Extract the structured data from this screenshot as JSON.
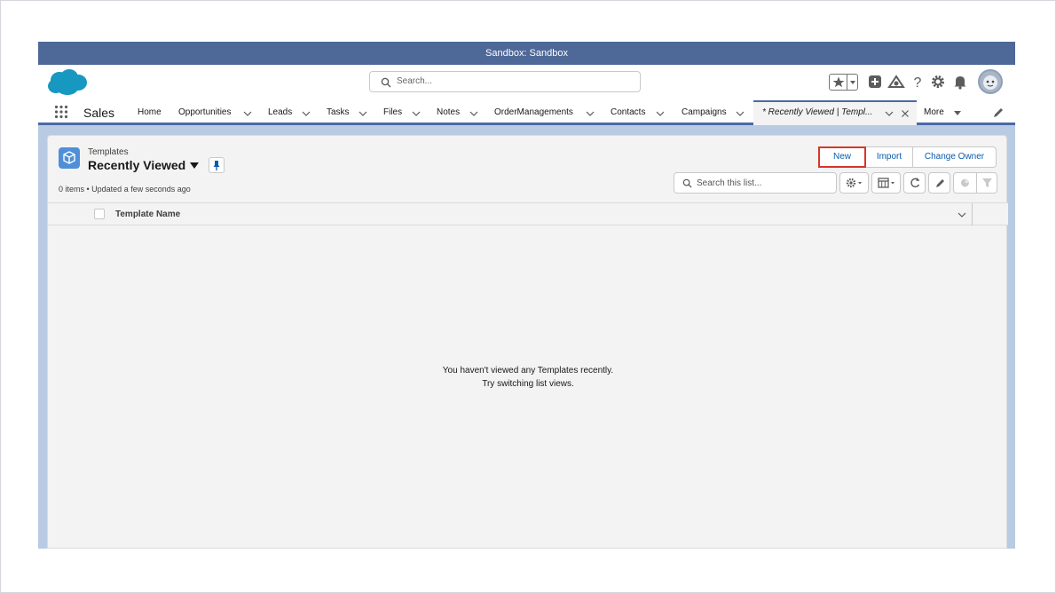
{
  "sandbox_banner": "Sandbox: Sandbox",
  "header": {
    "search_placeholder": "Search...",
    "icons": [
      "salesforce-cloud-logo",
      "star-icon",
      "plus-icon",
      "trailhead-icon",
      "help-icon",
      "gear-icon",
      "bell-icon",
      "avatar"
    ]
  },
  "nav": {
    "app_name": "Sales",
    "items": [
      {
        "label": "Home",
        "has_menu": false
      },
      {
        "label": "Opportunities",
        "has_menu": true
      },
      {
        "label": "Leads",
        "has_menu": true
      },
      {
        "label": "Tasks",
        "has_menu": true
      },
      {
        "label": "Files",
        "has_menu": true
      },
      {
        "label": "Notes",
        "has_menu": true
      },
      {
        "label": "OrderManagements",
        "has_menu": true
      },
      {
        "label": "Contacts",
        "has_menu": true
      },
      {
        "label": "Campaigns",
        "has_menu": true
      }
    ],
    "active_tab": "* Recently Viewed | Templ...",
    "more_label": "More"
  },
  "list_view": {
    "object_type": "Templates",
    "list_name": "Recently Viewed",
    "status": "0 items • Updated a few seconds ago",
    "buttons": {
      "new": "New",
      "import": "Import",
      "change_owner": "Change Owner"
    },
    "search_placeholder": "Search this list...",
    "columns": [
      "Template Name"
    ],
    "empty_line1": "You haven't viewed any Templates recently.",
    "empty_line2": "Try switching list views."
  },
  "colors": {
    "sandbox_bar": "#4e6898",
    "brand_blue": "#4a6aa5",
    "link_blue": "#0b5cab",
    "highlight_red": "#d9352a",
    "template_icon": "#4f8fd8"
  }
}
